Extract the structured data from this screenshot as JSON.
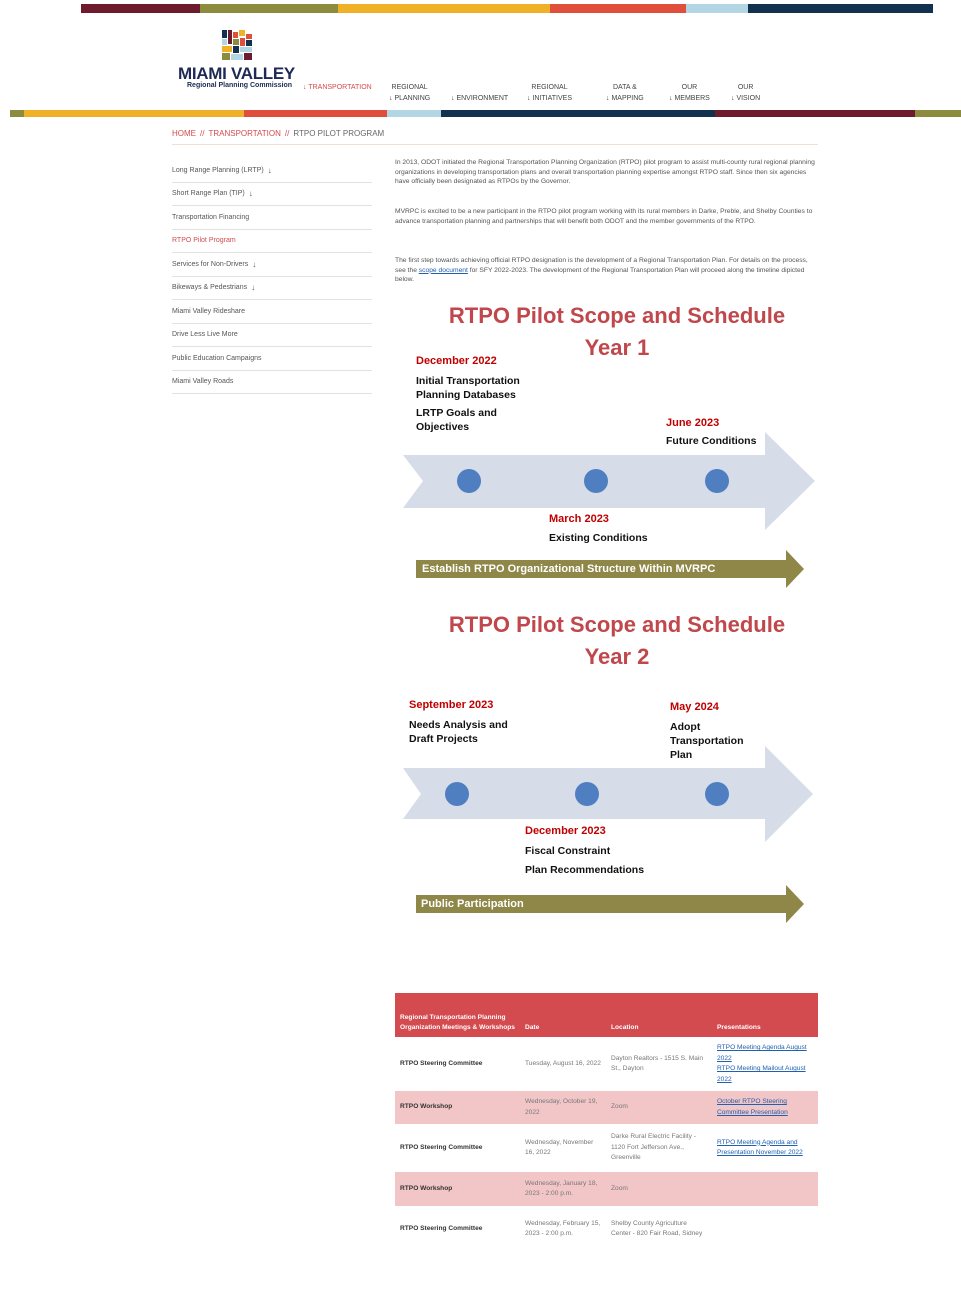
{
  "brand": {
    "name": "MIAMI VALLEY",
    "subtitle": "Regional Planning Commission",
    "colors": [
      "#6e1b2d",
      "#8c8b3e",
      "#f0b128",
      "#e04e3c",
      "#b2d6e4",
      "#12314f"
    ]
  },
  "nav": [
    {
      "line1": "",
      "line2": "↓ TRANSPORTATION"
    },
    {
      "line1": "REGIONAL",
      "line2": "↓ PLANNING"
    },
    {
      "line1": "",
      "line2": "↓ ENVIRONMENT"
    },
    {
      "line1": "REGIONAL",
      "line2": "↓ INITIATIVES"
    },
    {
      "line1": "DATA &",
      "line2": "↓ MAPPING"
    },
    {
      "line1": "OUR",
      "line2": "↓ MEMBERS"
    },
    {
      "line1": "OUR",
      "line2": "↓ VISION"
    }
  ],
  "breadcrumb": {
    "home": "HOME",
    "section": "TRANSPORTATION",
    "current": "RTPO PILOT PROGRAM",
    "separator": "//"
  },
  "sidebar": [
    {
      "label": "Long Range Planning (LRTP)",
      "arrow": "↓"
    },
    {
      "label": "Short Range Plan (TIP)",
      "arrow": "↓"
    },
    {
      "label": "Transportation Financing",
      "arrow": ""
    },
    {
      "label": "RTPO Pilot Program",
      "arrow": ""
    },
    {
      "label": "Services for Non-Drivers",
      "arrow": "↓"
    },
    {
      "label": "Bikeways & Pedestrians",
      "arrow": "↓"
    },
    {
      "label": "Miami Valley Rideshare",
      "arrow": ""
    },
    {
      "label": "Drive Less Live More",
      "arrow": ""
    },
    {
      "label": "Public Education Campaigns",
      "arrow": ""
    },
    {
      "label": "Miami Valley Roads",
      "arrow": ""
    }
  ],
  "content": {
    "para1": "In 2013, ODOT initiated the Regional Transportation Planning Organization (RTPO) pilot program to assist multi-county rural regional planning organizations in developing transportation plans and overall transportation planning expertise amongst RTPO staff. Since then six agencies have officially been designated as RTPOs by the Governor.",
    "para2": "MVRPC is excited to be a new participant in the RTPO pilot program working with its rural members in Darke, Preble, and Shelby Counties to advance transportation planning and partnerships that will benefit both ODOT and the member governments of the RTPO.",
    "para3_before": "The first step towards achieving official RTPO designation is the development of a Regional Transportation Plan. For details on the process, see the ",
    "para3_link": "scope document",
    "para3_after": " for SFY 2022-2023. The development of the Regional Transportation Plan will proceed along the timeline dipicted below."
  },
  "year1": {
    "title_line1": "RTPO Pilot Scope and Schedule",
    "title_line2": "Year 1",
    "m1_date": "December 2022",
    "m1_text1": "Initial Transportation Planning Databases",
    "m1_text2": "LRTP Goals and Objectives",
    "m2_date": "March 2023",
    "m2_text": "Existing Conditions",
    "m3_date": "June 2023",
    "m3_text": "Future Conditions",
    "banner": "Establish RTPO Organizational Structure Within MVRPC"
  },
  "year2": {
    "title_line1": "RTPO Pilot Scope and Schedule",
    "title_line2": "Year 2",
    "m1_date": "September 2023",
    "m1_text": "Needs Analysis and Draft Projects",
    "m2_date": "December 2023",
    "m2_text1": "Fiscal Constraint",
    "m2_text2": "Plan Recommendations",
    "m3_date": "May 2024",
    "m3_text": "Adopt Transportation Plan",
    "banner": "Public Participation"
  },
  "table": {
    "headers": [
      "Regional Transportation Planning Organization Meetings & Workshops",
      "Date",
      "Location",
      "Presentations"
    ],
    "rows": [
      {
        "name": "RTPO Steering Committee",
        "date": "Tuesday, August 16, 2022",
        "location": "Dayton Realtors - 1515 S. Main St., Dayton",
        "links": [
          "RTPO Meeting Agenda August 2022",
          "RTPO Meeting Mailout August 2022"
        ]
      },
      {
        "name": "RTPO Workshop",
        "date": "Wednesday, October 19, 2022",
        "location": "Zoom",
        "links": [
          "October RTPO Steering Committee Presentation"
        ]
      },
      {
        "name": "RTPO Steering Committee",
        "date": "Wednesday, November 16, 2022",
        "location": "Darke Rural Electric Facility - 1120 Fort Jefferson Ave., Greenville",
        "links": [
          "RTPO Meeting Agenda and Presentation November 2022"
        ]
      },
      {
        "name": "RTPO Workshop",
        "date": "Wednesday, January 18, 2023 - 2:00 p.m.",
        "location": "Zoom",
        "links": []
      },
      {
        "name": "RTPO Steering Committee",
        "date": "Wednesday, February 15, 2023 - 2:00 p.m.",
        "location": "Shelby County Agriculture Center - 820 Fair Road, Sidney",
        "links": []
      }
    ]
  }
}
